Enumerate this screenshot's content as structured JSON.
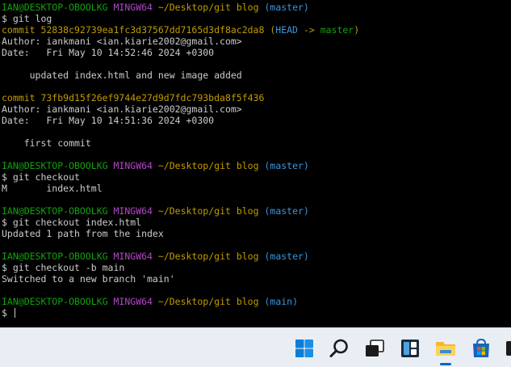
{
  "terminal": {
    "lines": [
      {
        "type": "prompt",
        "user": "IAN@DESKTOP-OBOOLKG",
        "msys": "MINGW64",
        "path": "~/Desktop/git blog",
        "branch": "(master)"
      },
      {
        "type": "text",
        "text": "$ git log"
      },
      {
        "type": "commit",
        "hash": "commit 52838c92739ea1fc3d37567dd7165d3df8ac2da8",
        "open": " (",
        "head": "HEAD",
        "arrow": " -> ",
        "ref": "master",
        "close": ")"
      },
      {
        "type": "text",
        "text": "Author: iankmani <ian.kiarie2002@gmail.com>"
      },
      {
        "type": "text",
        "text": "Date:   Fri May 10 14:52:46 2024 +0300"
      },
      {
        "type": "text",
        "text": ""
      },
      {
        "type": "text",
        "text": "     updated index.html and new image added"
      },
      {
        "type": "text",
        "text": ""
      },
      {
        "type": "commit2",
        "hash": "commit 73fb9d15f26ef9744e27d9d7fdc793bda8f5f436"
      },
      {
        "type": "text",
        "text": "Author: iankmani <ian.kiarie2002@gmail.com>"
      },
      {
        "type": "text",
        "text": "Date:   Fri May 10 14:51:36 2024 +0300"
      },
      {
        "type": "text",
        "text": ""
      },
      {
        "type": "text",
        "text": "    first commit"
      },
      {
        "type": "text",
        "text": ""
      },
      {
        "type": "prompt",
        "user": "IAN@DESKTOP-OBOOLKG",
        "msys": "MINGW64",
        "path": "~/Desktop/git blog",
        "branch": "(master)"
      },
      {
        "type": "text",
        "text": "$ git checkout"
      },
      {
        "type": "text",
        "text": "M       index.html"
      },
      {
        "type": "text",
        "text": ""
      },
      {
        "type": "prompt",
        "user": "IAN@DESKTOP-OBOOLKG",
        "msys": "MINGW64",
        "path": "~/Desktop/git blog",
        "branch": "(master)"
      },
      {
        "type": "text",
        "text": "$ git checkout index.html"
      },
      {
        "type": "text",
        "text": "Updated 1 path from the index"
      },
      {
        "type": "text",
        "text": ""
      },
      {
        "type": "prompt",
        "user": "IAN@DESKTOP-OBOOLKG",
        "msys": "MINGW64",
        "path": "~/Desktop/git blog",
        "branch": "(master)"
      },
      {
        "type": "text",
        "text": "$ git checkout -b main"
      },
      {
        "type": "text",
        "text": "Switched to a new branch 'main'"
      },
      {
        "type": "text",
        "text": ""
      },
      {
        "type": "prompt",
        "user": "IAN@DESKTOP-OBOOLKG",
        "msys": "MINGW64",
        "path": "~/Desktop/git blog",
        "branch": "(main)"
      },
      {
        "type": "input",
        "text": "$ "
      }
    ]
  },
  "taskbar": {
    "icons": [
      {
        "name": "windows-start-icon"
      },
      {
        "name": "search-icon"
      },
      {
        "name": "task-view-icon"
      },
      {
        "name": "widgets-icon"
      },
      {
        "name": "file-explorer-icon",
        "active": true
      },
      {
        "name": "microsoft-store-icon"
      }
    ]
  },
  "colors": {
    "prompt_user": "#13a10e",
    "prompt_msys": "#b148c6",
    "prompt_path": "#c19c00",
    "prompt_branch": "#3a96dd",
    "text": "#cccccc",
    "background": "#000000",
    "taskbar": "#e9eef4"
  }
}
